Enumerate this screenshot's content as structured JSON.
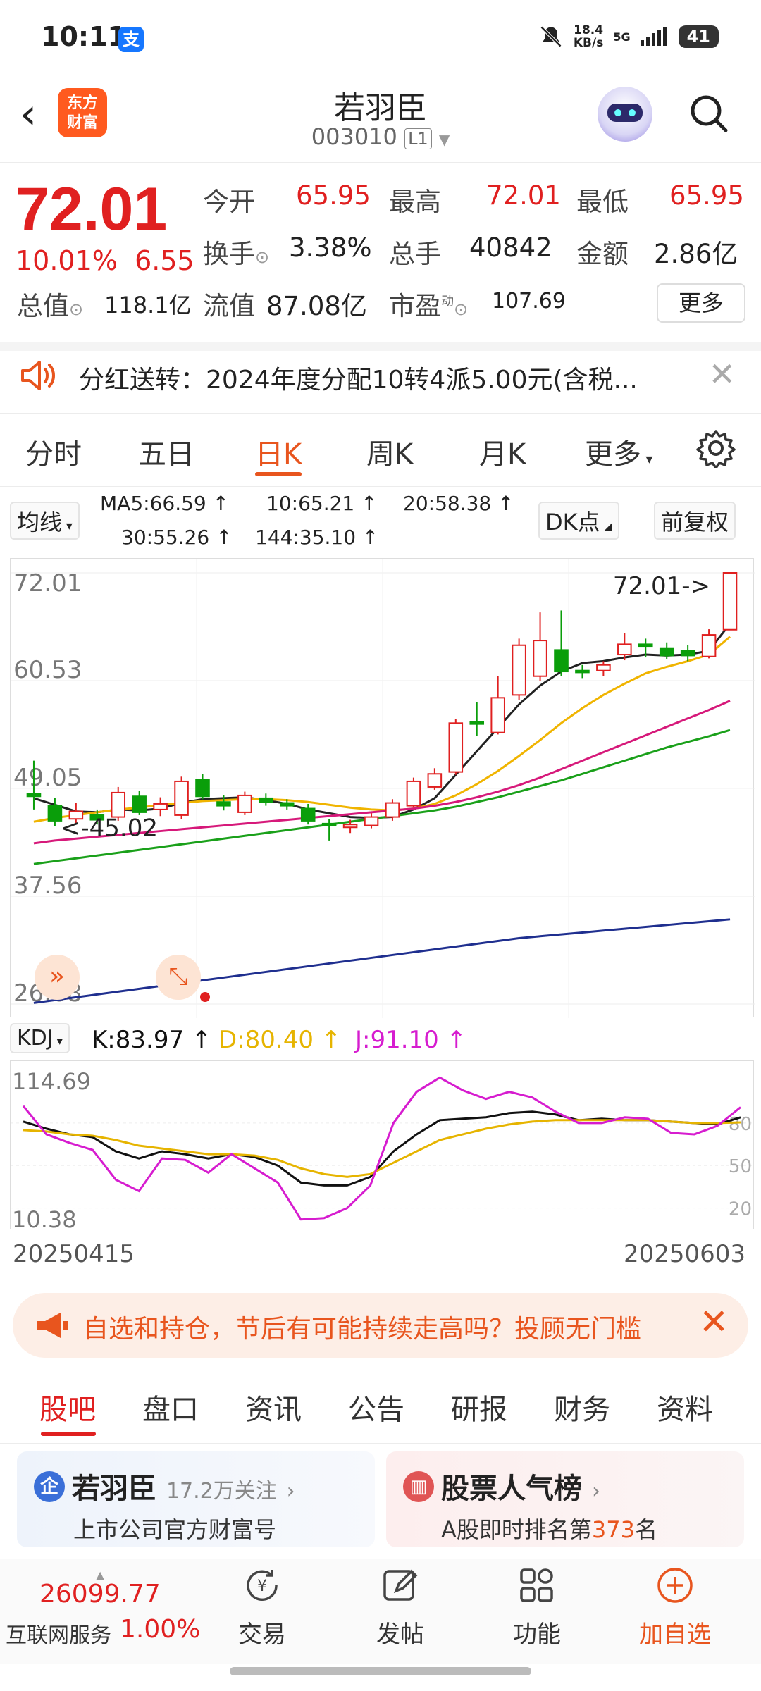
{
  "status_bar": {
    "time": "10:11",
    "alipay_badge": "支",
    "net_speed_value": "18.4",
    "net_speed_unit": "KB/s",
    "network": "5G",
    "battery": "41"
  },
  "header": {
    "logo_line1": "东方",
    "logo_line2": "财富",
    "stock_name": "若羽臣",
    "stock_code": "003010",
    "level": "L1"
  },
  "quote": {
    "price": "72.01",
    "change_pct": "10.01%",
    "change_amt": "6.55",
    "open_label": "今开",
    "open": "65.95",
    "high_label": "最高",
    "high": "72.01",
    "low_label": "最低",
    "low": "65.95",
    "turnover_label": "换手",
    "turnover": "3.38%",
    "volume_label": "总手",
    "volume": "40842",
    "amount_label": "金额",
    "amount": "2.86亿",
    "mktcap_label": "总值",
    "mktcap": "118.1亿",
    "float_label": "流值",
    "float": "87.08亿",
    "pe_label": "市盈",
    "pe_sup": "动",
    "pe": "107.69",
    "more_button": "更多"
  },
  "notice": {
    "text": "分红送转：2024年度分配10转4派5.00元(含税..."
  },
  "tabs": [
    "分时",
    "五日",
    "日K",
    "周K",
    "月K",
    "更多"
  ],
  "active_tab": "日K",
  "ma": {
    "selector": "均线",
    "ma5": "MA5:66.59 ↑",
    "ma10": "10:65.21 ↑",
    "ma20": "20:58.38 ↑",
    "ma30": "30:55.26 ↑",
    "ma144": "144:35.10 ↑",
    "dk_button": "DK点",
    "adjust_button": "前复权",
    "colors": {
      "ma5": "#222222",
      "ma10": "#f0b400",
      "ma20": "#d6197a",
      "ma30": "#1aa01a",
      "ma144": "#1f2f8f"
    }
  },
  "chart_data": [
    {
      "type": "candlestick",
      "y_axis_labels": [
        "72.01",
        "60.53",
        "49.05",
        "37.56",
        "26.08"
      ],
      "ylim": [
        26.08,
        72.01
      ],
      "annotations": {
        "high_marker": "72.01->",
        "low_marker": "<-45.02"
      },
      "candles": [
        {
          "o": 48.5,
          "c": 48.2,
          "h": 52.0,
          "l": 46.8
        },
        {
          "o": 47.2,
          "c": 45.6,
          "h": 48.0,
          "l": 45.02
        },
        {
          "o": 45.8,
          "c": 46.6,
          "h": 47.5,
          "l": 45.3
        },
        {
          "o": 46.2,
          "c": 45.7,
          "h": 46.8,
          "l": 45.2
        },
        {
          "o": 46.0,
          "c": 48.6,
          "h": 49.2,
          "l": 45.6
        },
        {
          "o": 48.2,
          "c": 46.5,
          "h": 48.8,
          "l": 46.2
        },
        {
          "o": 46.8,
          "c": 47.4,
          "h": 48.1,
          "l": 46.1
        },
        {
          "o": 46.2,
          "c": 49.8,
          "h": 50.3,
          "l": 45.8
        },
        {
          "o": 50.0,
          "c": 48.2,
          "h": 50.6,
          "l": 47.9
        },
        {
          "o": 47.6,
          "c": 47.2,
          "h": 48.3,
          "l": 46.7
        },
        {
          "o": 46.5,
          "c": 48.3,
          "h": 48.7,
          "l": 46.2
        },
        {
          "o": 48.0,
          "c": 47.6,
          "h": 48.5,
          "l": 47.2
        },
        {
          "o": 47.5,
          "c": 47.2,
          "h": 47.9,
          "l": 46.8
        },
        {
          "o": 46.9,
          "c": 45.6,
          "h": 47.4,
          "l": 45.2
        },
        {
          "o": 45.3,
          "c": 45.1,
          "h": 45.8,
          "l": 43.5
        },
        {
          "o": 44.9,
          "c": 45.2,
          "h": 45.7,
          "l": 44.3
        },
        {
          "o": 45.1,
          "c": 46.0,
          "h": 46.4,
          "l": 44.8
        },
        {
          "o": 46.0,
          "c": 47.5,
          "h": 47.9,
          "l": 45.6
        },
        {
          "o": 47.2,
          "c": 49.8,
          "h": 50.2,
          "l": 47.0
        },
        {
          "o": 49.2,
          "c": 50.6,
          "h": 51.2,
          "l": 48.9
        },
        {
          "o": 50.8,
          "c": 56.0,
          "h": 56.4,
          "l": 50.5
        },
        {
          "o": 56.1,
          "c": 55.9,
          "h": 58.2,
          "l": 54.6
        },
        {
          "o": 55.0,
          "c": 58.7,
          "h": 61.0,
          "l": 54.8
        },
        {
          "o": 59.0,
          "c": 64.3,
          "h": 65.0,
          "l": 58.5
        },
        {
          "o": 61.0,
          "c": 64.8,
          "h": 67.8,
          "l": 60.5
        },
        {
          "o": 63.8,
          "c": 61.5,
          "h": 68.0,
          "l": 61.0
        },
        {
          "o": 61.6,
          "c": 61.4,
          "h": 62.2,
          "l": 60.8
        },
        {
          "o": 61.6,
          "c": 62.2,
          "h": 62.6,
          "l": 61.0
        },
        {
          "o": 63.3,
          "c": 64.4,
          "h": 65.6,
          "l": 62.7
        },
        {
          "o": 64.4,
          "c": 64.2,
          "h": 65.0,
          "l": 63.0
        },
        {
          "o": 64.0,
          "c": 63.2,
          "h": 64.6,
          "l": 62.8
        },
        {
          "o": 63.7,
          "c": 63.2,
          "h": 64.3,
          "l": 62.6
        },
        {
          "o": 63.1,
          "c": 65.4,
          "h": 66.0,
          "l": 62.9
        },
        {
          "o": 65.95,
          "c": 72.01,
          "h": 72.01,
          "l": 65.95
        }
      ],
      "ma_lines": {
        "ma5": [
          48.0,
          47.3,
          46.6,
          46.5,
          46.8,
          46.7,
          46.9,
          47.5,
          47.9,
          48.0,
          48.1,
          47.8,
          47.4,
          46.8,
          46.4,
          46.0,
          45.9,
          46.0,
          46.8,
          48.0,
          50.5,
          53.0,
          55.5,
          58.0,
          60.0,
          61.5,
          62.4,
          62.6,
          63.0,
          63.3,
          63.2,
          63.3,
          63.7,
          66.59
        ],
        "ma10": [
          45.5,
          45.9,
          46.2,
          46.5,
          46.8,
          47.0,
          47.3,
          47.5,
          47.7,
          47.8,
          47.9,
          47.9,
          47.8,
          47.6,
          47.3,
          47.0,
          46.8,
          46.7,
          46.9,
          47.4,
          48.3,
          49.5,
          50.9,
          52.5,
          54.2,
          56.0,
          57.6,
          59.0,
          60.2,
          61.3,
          62.0,
          62.6,
          63.3,
          65.21
        ],
        "ma20": [
          43.2,
          43.5,
          43.7,
          43.9,
          44.1,
          44.3,
          44.5,
          44.7,
          44.9,
          45.1,
          45.3,
          45.5,
          45.7,
          45.9,
          46.1,
          46.3,
          46.5,
          46.7,
          46.9,
          47.2,
          47.6,
          48.1,
          48.7,
          49.4,
          50.2,
          51.1,
          52.0,
          52.9,
          53.8,
          54.7,
          55.6,
          56.5,
          57.4,
          58.38
        ],
        "ma30": [
          41.0,
          41.3,
          41.6,
          41.9,
          42.2,
          42.5,
          42.8,
          43.1,
          43.4,
          43.7,
          44.0,
          44.3,
          44.6,
          44.9,
          45.2,
          45.5,
          45.8,
          46.1,
          46.4,
          46.7,
          47.1,
          47.6,
          48.1,
          48.7,
          49.3,
          49.9,
          50.6,
          51.3,
          52.0,
          52.7,
          53.4,
          54.0,
          54.6,
          55.26
        ],
        "ma144": [
          26.2,
          26.5,
          26.8,
          27.1,
          27.4,
          27.7,
          28.0,
          28.3,
          28.6,
          28.9,
          29.2,
          29.5,
          29.8,
          30.1,
          30.4,
          30.7,
          31.0,
          31.3,
          31.6,
          31.9,
          32.2,
          32.5,
          32.8,
          33.1,
          33.3,
          33.5,
          33.7,
          33.9,
          34.1,
          34.3,
          34.5,
          34.7,
          34.9,
          35.1
        ]
      },
      "up_color": "#e02020",
      "down_color": "#0a9e0a"
    },
    {
      "type": "line",
      "indicator": "KDJ",
      "y_axis_labels": [
        "114.69",
        "10.38"
      ],
      "right_labels": [
        "80",
        "50",
        "20"
      ],
      "ylim": [
        10.38,
        114.69
      ],
      "series": [
        {
          "name": "K",
          "label": "K:83.97 ↑",
          "color": "#111111",
          "values": [
            81,
            76,
            72,
            70,
            60,
            55,
            60,
            58,
            55,
            58,
            56,
            50,
            38,
            36,
            36,
            42,
            60,
            72,
            82,
            83,
            84,
            87,
            88,
            86,
            82,
            83,
            82,
            82,
            81,
            80,
            79,
            83.97
          ]
        },
        {
          "name": "D",
          "label": "D:80.40 ↑",
          "color": "#e6b400",
          "values": [
            75,
            74,
            72,
            71,
            68,
            64,
            62,
            60,
            58,
            58,
            57,
            54,
            48,
            44,
            42,
            44,
            52,
            60,
            68,
            72,
            76,
            79,
            81,
            82,
            82,
            82,
            82,
            82,
            81,
            80,
            80,
            80.4
          ]
        },
        {
          "name": "J",
          "label": "J:91.10 ↑",
          "color": "#d61ccf",
          "values": [
            92,
            72,
            66,
            61,
            40,
            32,
            55,
            54,
            45,
            58,
            48,
            38,
            12,
            13,
            20,
            36,
            80,
            102,
            112,
            103,
            97,
            102,
            98,
            88,
            80,
            80,
            84,
            83,
            73,
            72,
            78,
            91.1
          ]
        }
      ]
    }
  ],
  "date_start": "20250415",
  "date_end": "20250603",
  "banner": {
    "text": "自选和持仓，节后有可能持续走高吗？投顾无门槛"
  },
  "bottom_tabs": [
    "股吧",
    "盘口",
    "资讯",
    "公告",
    "研报",
    "财务",
    "资料"
  ],
  "active_bottom_tab": "股吧",
  "card1": {
    "badge": "企",
    "title": "若羽臣",
    "meta": "17.2万关注",
    "subtitle": "上市公司官方财富号"
  },
  "card2": {
    "title": "股票人气榜",
    "sub_prefix": "A股即时排名第",
    "rank": "373",
    "sub_suffix": "名"
  },
  "index": {
    "value": "26099.77",
    "label": "互联网服务",
    "pct": "1.00%"
  },
  "nav": [
    "交易",
    "发帖",
    "功能",
    "加自选"
  ]
}
